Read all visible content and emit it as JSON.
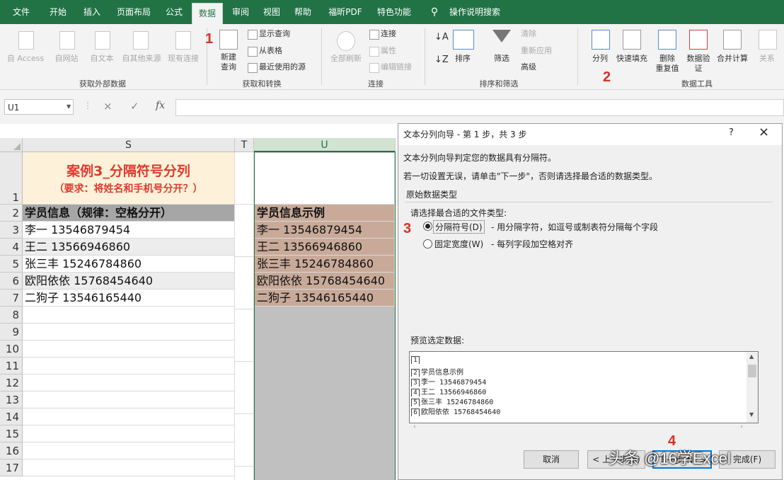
{
  "tabs": [
    "文件",
    "开始",
    "插入",
    "页面布局",
    "公式",
    "数据",
    "审阅",
    "视图",
    "帮助",
    "福昕PDF",
    "特色功能",
    "操作说明搜索"
  ],
  "active_tab": "数据",
  "ribbon": {
    "get_external": {
      "items": [
        "自 Access",
        "自网站",
        "自文本",
        "自其他来源",
        "现有连接"
      ],
      "label": "获取外部数据"
    },
    "get_transform": {
      "new_query": "新建\n查询",
      "show_query": "显示查询",
      "from_table": "从表格",
      "recent": "最近使用的源",
      "label": "获取和转换"
    },
    "connections": {
      "refresh_all": "全部刷新",
      "connections": "连接",
      "properties": "属性",
      "edit_links": "编辑链接",
      "label": "连接"
    },
    "sort_filter": {
      "sort": "排序",
      "filter": "筛选",
      "clear": "清除",
      "reapply": "重新应用",
      "advanced": "高级",
      "label": "排序和筛选"
    },
    "data_tools": {
      "split": "分列",
      "flash_fill": "快速填充",
      "remove_dup": "删除\n重复值",
      "validation": "数据验\n证",
      "consolidate": "合并计算",
      "relationships": "关系",
      "label": "数据工具"
    }
  },
  "markers": {
    "m1": "1",
    "m2": "2",
    "m3": "3",
    "m4": "4"
  },
  "name_box": "U1",
  "formula_icons": [
    "×",
    "✓",
    "fx"
  ],
  "columns": [
    "S",
    "T",
    "U"
  ],
  "rows": [
    "1",
    "2",
    "3",
    "4",
    "5",
    "6",
    "7",
    "8",
    "9",
    "10",
    "11",
    "12",
    "13",
    "14",
    "15",
    "16",
    "17"
  ],
  "title_cell": {
    "line1": "案例3_分隔符号分列",
    "line2": "（要求：将姓名和手机号分开？）"
  },
  "s_col": [
    "学员信息（规律：空格分开）",
    "李一 13546879454",
    "王二 13566946860",
    "张三丰 15246784860",
    "欧阳依依 15768454640",
    "二狗子 13546165440"
  ],
  "u_col": [
    "学员信息示例",
    "李一 13546879454",
    "王二 13566946860",
    "张三丰 15246784860",
    "欧阳依依 15768454640",
    "二狗子 13546165440"
  ],
  "dialog": {
    "title": "文本分列向导 - 第 1 步，共 3 步",
    "help": "?",
    "close": "×",
    "intro1": "文本分列向导判定您的数据具有分隔符。",
    "intro2": "若一切设置无误，请单击\"下一步\"，否则请选择最合适的数据类型。",
    "group": "原始数据类型",
    "choose": "请选择最合适的文件类型:",
    "opt1": "分隔符号(D)",
    "opt1_desc": "- 用分隔字符，如逗号或制表符分隔每个字段",
    "opt2": "固定宽度(W)",
    "opt2_desc": "- 每列字段加空格对齐",
    "preview_label": "预览选定数据:",
    "preview_rows": [
      {
        "n": "1",
        "t": ""
      },
      {
        "n": "2",
        "t": "学员信息示例"
      },
      {
        "n": "3",
        "t": "李一 13546879454"
      },
      {
        "n": "4",
        "t": "王二 13566946860"
      },
      {
        "n": "5",
        "t": "张三丰 15246784860"
      },
      {
        "n": "6",
        "t": "欧阳依依 15768454640"
      }
    ],
    "btn_cancel": "取消",
    "btn_back": "< 上一步(B)",
    "btn_next": "下一步(N) >",
    "btn_finish": "完成(F)"
  },
  "watermark": "头条 @16学Excel",
  "colors": {
    "excel_green": "#217346",
    "header_gray": "#a6a6a6",
    "title_bg": "#fdf2d9",
    "u_fill": "#c9aa99",
    "red": "#d93025"
  }
}
